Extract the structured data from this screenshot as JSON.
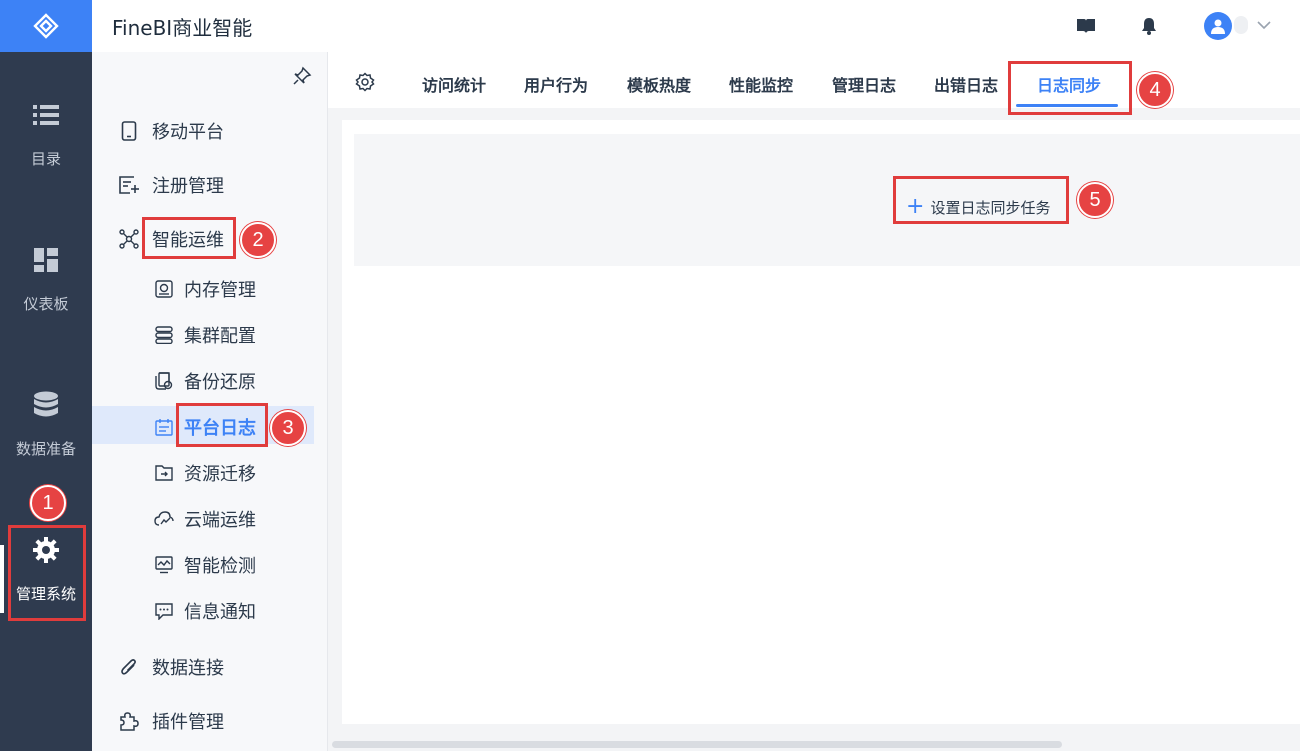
{
  "app": {
    "title": "FineBI商业智能"
  },
  "leftnav": {
    "items": [
      {
        "label": "目录",
        "icon": "list-icon"
      },
      {
        "label": "仪表板",
        "icon": "dashboard-icon"
      },
      {
        "label": "数据准备",
        "icon": "database-icon"
      },
      {
        "label": "管理系统",
        "icon": "gear-icon",
        "active": true
      }
    ]
  },
  "sidebar": {
    "items": [
      {
        "label": "移动平台",
        "icon": "tablet-icon"
      },
      {
        "label": "注册管理",
        "icon": "register-icon"
      },
      {
        "label": "智能运维",
        "icon": "network-icon"
      },
      {
        "label": "数据连接",
        "icon": "paperclip-icon"
      },
      {
        "label": "插件管理",
        "icon": "puzzle-icon"
      }
    ],
    "subitems": [
      {
        "label": "内存管理",
        "icon": "memory-icon"
      },
      {
        "label": "集群配置",
        "icon": "server-icon"
      },
      {
        "label": "备份还原",
        "icon": "backup-icon"
      },
      {
        "label": "平台日志",
        "icon": "calendar-icon",
        "selected": true
      },
      {
        "label": "资源迁移",
        "icon": "folder-arrow-icon"
      },
      {
        "label": "云端运维",
        "icon": "cloud-icon"
      },
      {
        "label": "智能检测",
        "icon": "monitor-icon"
      },
      {
        "label": "信息通知",
        "icon": "message-icon"
      }
    ]
  },
  "tabs": [
    "访问统计",
    "用户行为",
    "模板热度",
    "性能监控",
    "管理日志",
    "出错日志",
    "日志同步"
  ],
  "active_tab": "日志同步",
  "main": {
    "add_task_label": "设置日志同步任务"
  },
  "annotations": [
    "1",
    "2",
    "3",
    "4",
    "5"
  ],
  "colors": {
    "accent": "#3d82f6",
    "nav_bg": "#2f3b4f",
    "highlight": "#e03c3c"
  }
}
